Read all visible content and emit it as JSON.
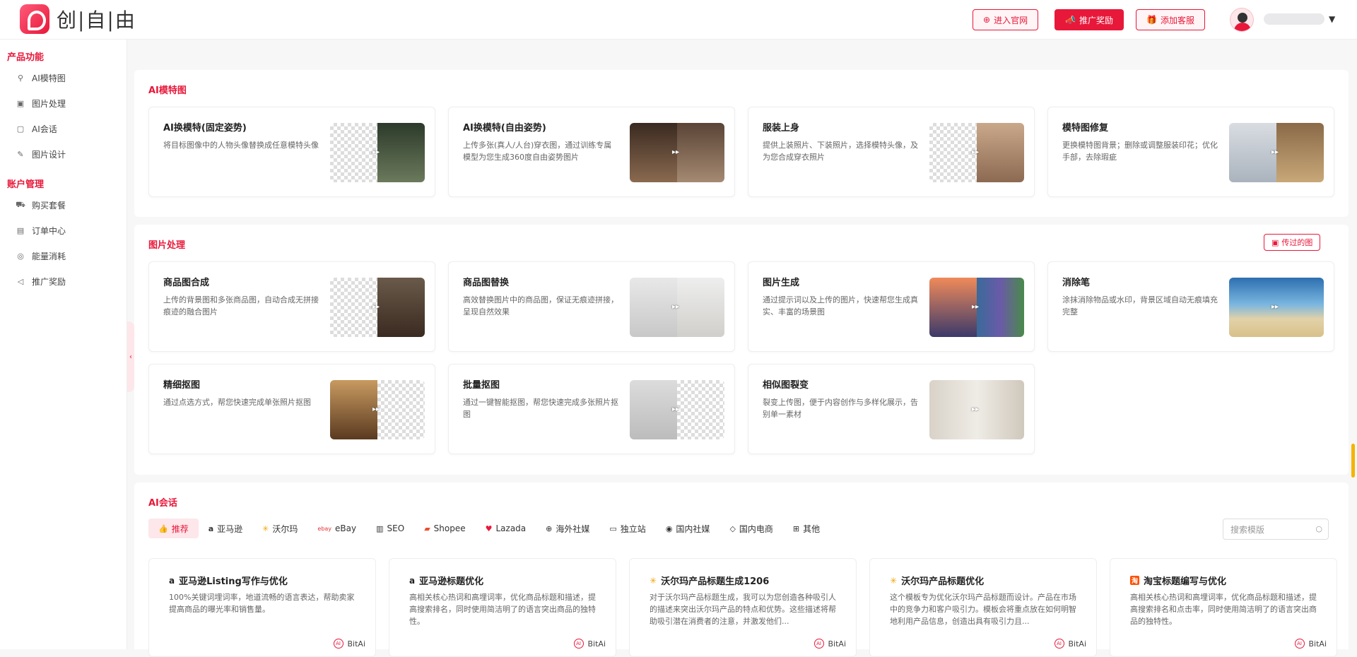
{
  "header": {
    "logo_text": "创|自|由",
    "buttons": [
      {
        "label": "进入官网",
        "icon": "globe-icon"
      },
      {
        "label": "推广奖励",
        "icon": "megaphone-icon"
      },
      {
        "label": "添加客服",
        "icon": "gift-icon"
      }
    ]
  },
  "sidebar": {
    "groups": [
      {
        "title": "产品功能",
        "items": [
          {
            "label": "AI模特图",
            "icon": "model-icon"
          },
          {
            "label": "图片处理",
            "icon": "image-icon"
          },
          {
            "label": "AI会话",
            "icon": "chat-icon"
          },
          {
            "label": "图片设计",
            "icon": "design-icon"
          }
        ]
      },
      {
        "title": "账户管理",
        "items": [
          {
            "label": "购买套餐",
            "icon": "cart-icon"
          },
          {
            "label": "订单中心",
            "icon": "order-icon"
          },
          {
            "label": "能量消耗",
            "icon": "energy-icon"
          },
          {
            "label": "推广奖励",
            "icon": "megaphone-icon"
          }
        ]
      }
    ]
  },
  "ai_model": {
    "title": "AI模特图",
    "cards": [
      {
        "title": "AI换模特(固定姿势)",
        "desc": "将目标图像中的人物头像替换成任意模特头像"
      },
      {
        "title": "AI换模特(自由姿势)",
        "desc": "上传多张(真人/人台)穿衣图，通过训练专属模型为您生成360度自由姿势图片"
      },
      {
        "title": "服装上身",
        "desc": "提供上装照片、下装照片，选择模特头像，及为您合成穿衣照片"
      },
      {
        "title": "模特图修复",
        "desc": "更换模特图背景；删除或调整服装印花；优化手部，去除瑕疵"
      }
    ]
  },
  "image_proc": {
    "title": "图片处理",
    "history_label": "传过的图",
    "cards": [
      {
        "title": "商品图合成",
        "desc": "上传的背景图和多张商品图，自动合成无拼接痕迹的融合图片"
      },
      {
        "title": "商品图替换",
        "desc": "高效替换图片中的商品图，保证无痕迹拼接，呈现自然效果"
      },
      {
        "title": "图片生成",
        "desc": "通过提示词以及上传的图片，快速帮您生成真实、丰富的场景图"
      },
      {
        "title": "消除笔",
        "desc": "涂抹消除物品或水印，背景区域自动无痕填充完整"
      },
      {
        "title": "精细抠图",
        "desc": "通过点选方式，帮您快速完成单张照片抠图"
      },
      {
        "title": "批量抠图",
        "desc": "通过一键智能抠图，帮您快速完成多张照片抠图"
      },
      {
        "title": "相似图裂变",
        "desc": "裂变上传图，便于内容创作与多样化展示，告别单一素材"
      }
    ]
  },
  "ai_chat": {
    "title": "AI会话",
    "tabs": [
      {
        "label": "推荐",
        "icon": "thumb-up-icon"
      },
      {
        "label": "亚马逊",
        "icon": "amazon-icon"
      },
      {
        "label": "沃尔玛",
        "icon": "walmart-icon"
      },
      {
        "label": "eBay",
        "icon": "ebay-icon"
      },
      {
        "label": "SEO",
        "icon": "bar-chart-icon"
      },
      {
        "label": "Shopee",
        "icon": "shopee-icon"
      },
      {
        "label": "Lazada",
        "icon": "heart-icon"
      },
      {
        "label": "海外社媒",
        "icon": "globe-icon"
      },
      {
        "label": "独立站",
        "icon": "store-icon"
      },
      {
        "label": "国内社媒",
        "icon": "social-icon"
      },
      {
        "label": "国内电商",
        "icon": "bag-icon"
      },
      {
        "label": "其他",
        "icon": "grid-icon"
      }
    ],
    "search_placeholder": "搜索模版",
    "cards": [
      {
        "title": "亚马逊Listing写作与优化",
        "icon": "amazon-icon",
        "desc": "100%关键词埋词率，地道流畅的语言表达，帮助卖家提高商品的曝光率和销售量。",
        "author": "BitAi"
      },
      {
        "title": "亚马逊标题优化",
        "icon": "amazon-icon",
        "desc": "高相关核心热词和高埋词率，优化商品标题和描述，提高搜索排名，同时使用简洁明了的语言突出商品的独特性。",
        "author": "BitAi"
      },
      {
        "title": "沃尔玛产品标题生成1206",
        "icon": "walmart-icon",
        "desc": "对于沃尔玛产品标题生成，我可以为您创造各种吸引人的描述来突出沃尔玛产品的特点和优势。这些描述将帮助吸引潜在消费者的注意，并激发他们...",
        "author": "BitAi"
      },
      {
        "title": "沃尔玛产品标题优化",
        "icon": "walmart-icon",
        "desc": "这个模板专为优化沃尔玛产品标题而设计。产品在市场中的竞争力和客户吸引力。模板会将重点放在如何明智地利用产品信息，创造出具有吸引力且...",
        "author": "BitAi"
      },
      {
        "title": "淘宝标题编写与优化",
        "icon": "taobao-icon",
        "desc": "高相关核心热词和高埋词率，优化商品标题和描述，提高搜索排名和点击率，同时使用简洁明了的语言突出商品的独特性。",
        "author": "BitAi"
      }
    ]
  }
}
